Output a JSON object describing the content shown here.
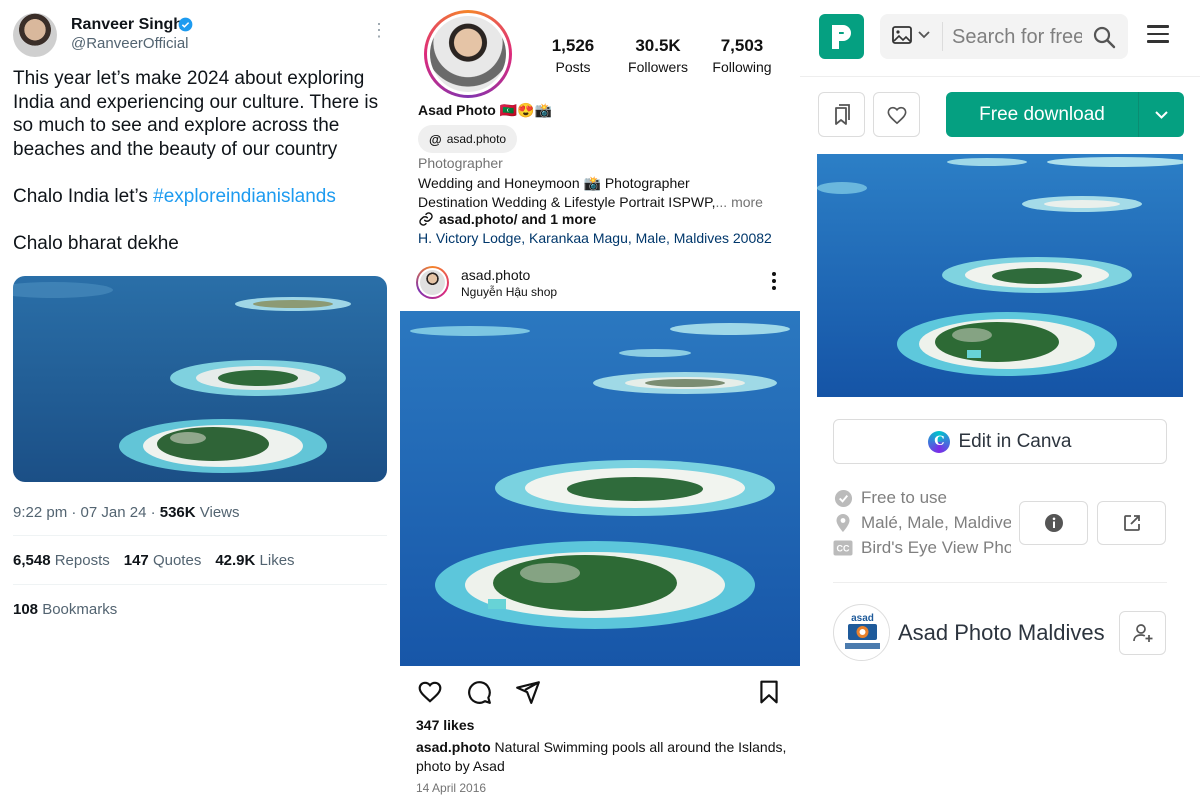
{
  "twitter": {
    "name": "Ranveer Singh",
    "handle": "@RanveerOfficial",
    "tweet": {
      "para1": "This year let’s make 2024 about exploring India and experiencing our culture. There is so much to see and explore across the beaches and the beauty of our country",
      "para2_prefix": "Chalo India let’s ",
      "hashtag": "#exploreindianislands",
      "para3": "Chalo bharat dekhe"
    },
    "meta": {
      "time": "9:22 pm · 07 Jan 24 · ",
      "views_count": "536K",
      "views_label": " Views"
    },
    "stats": {
      "reposts_count": "6,548",
      "reposts_label": "Reposts",
      "quotes_count": "147",
      "quotes_label": "Quotes",
      "likes_count": "42.9K",
      "likes_label": "Likes"
    },
    "bookmarks": {
      "count": "108",
      "label": "Bookmarks"
    },
    "colors": {
      "hashtag": "#1d9bf0",
      "verified": "#1d9bf0"
    }
  },
  "instagram": {
    "stats": [
      {
        "value": "1,526",
        "label": "Posts"
      },
      {
        "value": "30.5K",
        "label": "Followers"
      },
      {
        "value": "7,503",
        "label": "Following"
      }
    ],
    "profile_name": "Asad Photo 🇲🇻😍📸",
    "threads_handle": "asad.photo",
    "category": "Photographer",
    "bio_line1": "Wedding and Honeymoon  📸 Photographer",
    "bio_line2": "Destination Wedding & Lifestyle Portrait ISPWP,",
    "bio_more": "... more",
    "link": "asad.photo/ and 1 more",
    "address": "H. Victory Lodge, Karankaa Magu, Male, Maldives 20082",
    "post": {
      "username": "asad.photo",
      "subtitle": "Nguyễn Hậu shop",
      "likes": "347 likes",
      "caption_user": "asad.photo",
      "caption_text": " Natural Swimming pools all around the Islands, photo by Asad",
      "date": "14 April 2016"
    }
  },
  "pexels": {
    "search_placeholder": "Search for free photos",
    "download_label": "Free download",
    "canva_label": "Edit in Canva",
    "info": [
      {
        "icon": "check-circle-icon",
        "text": "Free to use"
      },
      {
        "icon": "location-pin-icon",
        "text": "Malé, Male, Maldives"
      },
      {
        "icon": "cc-icon",
        "text": "Bird's Eye View Photo"
      }
    ],
    "author_name": "Asad Photo Maldives",
    "author_logo_text": "asad",
    "colors": {
      "brand": "#05a081"
    }
  }
}
